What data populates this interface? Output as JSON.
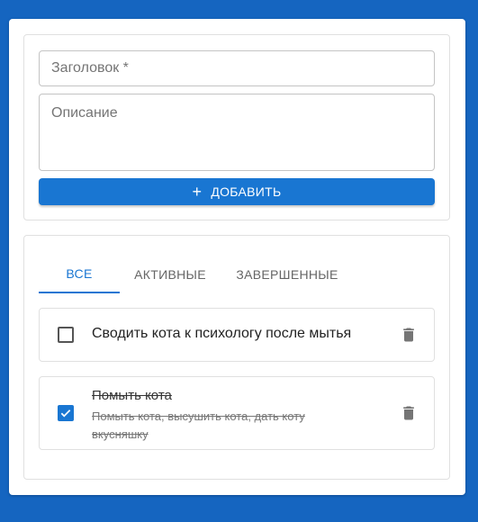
{
  "form": {
    "title_placeholder": "Заголовок *",
    "description_placeholder": "Описание",
    "add_button_label": "ДОБАВИТЬ"
  },
  "tabs": [
    {
      "label": "ВСЕ",
      "active": true
    },
    {
      "label": "АКТИВНЫЕ",
      "active": false
    },
    {
      "label": "ЗАВЕРШЕННЫЕ",
      "active": false
    }
  ],
  "todos": [
    {
      "title": "Сводить кота к психологу после мытья",
      "description": "",
      "completed": false
    },
    {
      "title": "Помыть кота",
      "description": "Помыть кота, высушить кота, дать коту вкусняшку",
      "completed": true
    }
  ],
  "colors": {
    "background": "#1565c0",
    "accent": "#1976d2"
  },
  "icons": {
    "add": "plus-icon",
    "delete": "trash-icon",
    "checked": "check-icon"
  }
}
